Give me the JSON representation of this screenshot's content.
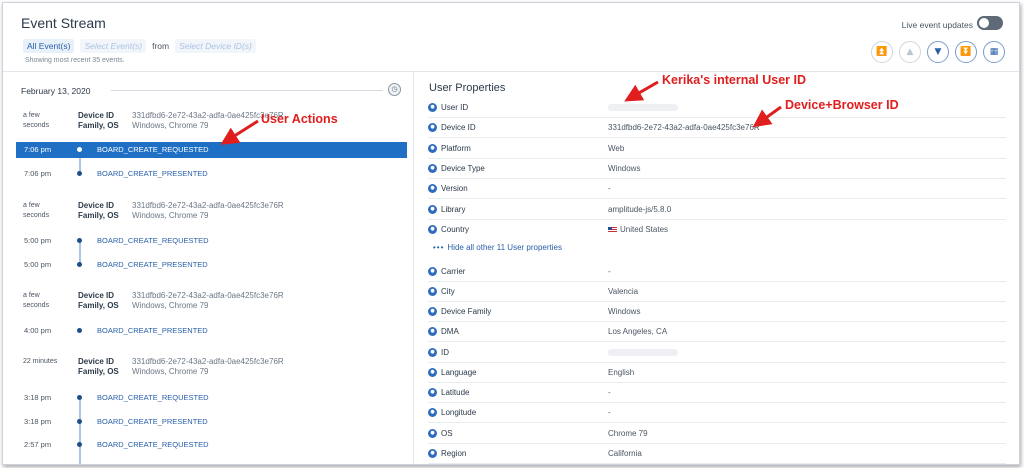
{
  "header": {
    "title": "Event Stream",
    "filter_all": "All Event(s)",
    "filter_select_events": "Select Event(s)",
    "filter_from": "from",
    "filter_select_devices": "Select Device ID(s)",
    "showing_text": "Showing most recent 35 events.",
    "live_label": "Live event updates",
    "nav_icons": [
      "chevron-double-up-icon",
      "chevron-up-icon",
      "chevron-down-icon",
      "chevron-double-down-icon",
      "calendar-icon"
    ]
  },
  "stream": {
    "date": "February 13, 2020",
    "device_key": "Device ID",
    "family_key": "Family, OS",
    "device_id": "331dfbd6-2e72-43a2-adfa-0ae425fc3e76R",
    "family_os": "Windows, Chrome 79",
    "sessions": [
      {
        "ts_line1": "a few",
        "ts_line2": "seconds",
        "events": [
          {
            "time": "7:06 pm",
            "name": "BOARD_CREATE_REQUESTED",
            "selected": true
          },
          {
            "time": "7:06 pm",
            "name": "BOARD_CREATE_PRESENTED"
          }
        ]
      },
      {
        "ts_line1": "a few",
        "ts_line2": "seconds",
        "events": [
          {
            "time": "5:00 pm",
            "name": "BOARD_CREATE_REQUESTED"
          },
          {
            "time": "5:00 pm",
            "name": "BOARD_CREATE_PRESENTED"
          }
        ]
      },
      {
        "ts_line1": "a few",
        "ts_line2": "seconds",
        "events": [
          {
            "time": "4:00 pm",
            "name": "BOARD_CREATE_PRESENTED"
          }
        ]
      },
      {
        "ts_line1": "22 minutes",
        "ts_line2": "",
        "events": [
          {
            "time": "3:18 pm",
            "name": "BOARD_CREATE_REQUESTED"
          },
          {
            "time": "3:18 pm",
            "name": "BOARD_CREATE_PRESENTED"
          },
          {
            "time": "2:57 pm",
            "name": "BOARD_CREATE_REQUESTED"
          }
        ]
      }
    ]
  },
  "user_properties": {
    "title": "User Properties",
    "hide_link": "Hide all other 11 User properties",
    "rows_top": [
      {
        "key": "User ID",
        "value": "",
        "blurred": true
      },
      {
        "key": "Device ID",
        "value": "331dfbd6-2e72-43a2-adfa-0ae425fc3e76R"
      },
      {
        "key": "Platform",
        "value": "Web"
      },
      {
        "key": "Device Type",
        "value": "Windows"
      },
      {
        "key": "Version",
        "value": "-"
      },
      {
        "key": "Library",
        "value": "amplitude-js/5.8.0"
      },
      {
        "key": "Country",
        "value": "United States",
        "flag": true
      }
    ],
    "rows_bottom": [
      {
        "key": "Carrier",
        "value": "-"
      },
      {
        "key": "City",
        "value": "Valencia"
      },
      {
        "key": "Device Family",
        "value": "Windows"
      },
      {
        "key": "DMA",
        "value": "Los Angeles, CA"
      },
      {
        "key": "ID",
        "value": "",
        "blurred": true
      },
      {
        "key": "Language",
        "value": "English"
      },
      {
        "key": "Latitude",
        "value": "-"
      },
      {
        "key": "Longitude",
        "value": "-"
      },
      {
        "key": "OS",
        "value": "Chrome 79"
      },
      {
        "key": "Region",
        "value": "California"
      }
    ]
  },
  "annotations": {
    "user_actions": "User Actions",
    "internal_user_id": "Kerika's internal User ID",
    "device_browser_id": "Device+Browser ID",
    "color": "#e01e1e"
  },
  "colors": {
    "accent": "#285fa8",
    "selected_row": "#1f6fc4"
  }
}
